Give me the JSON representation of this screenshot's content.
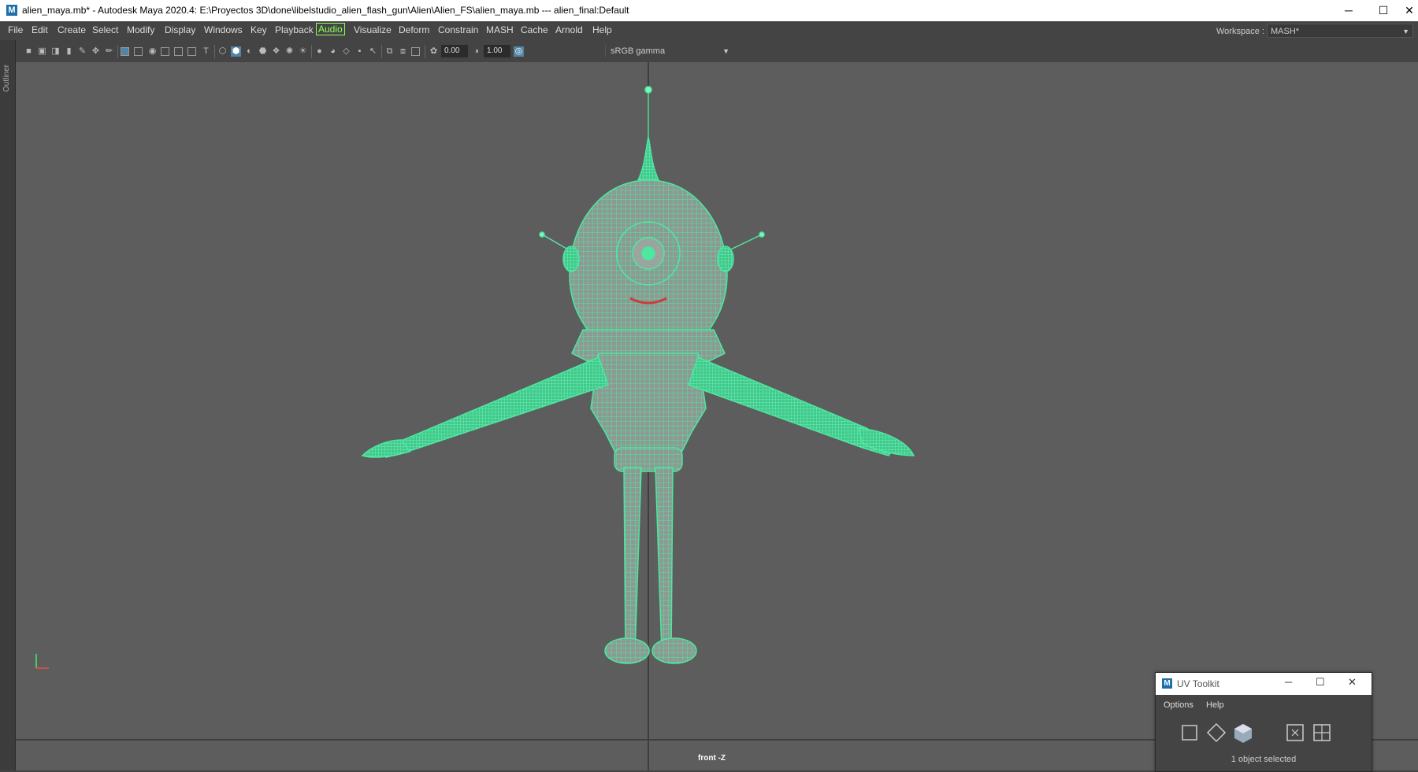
{
  "window": {
    "title": "alien_maya.mb* - Autodesk Maya 2020.4: E:\\Proyectos 3D\\done\\libelstudio_alien_flash_gun\\Alien\\Alien_FS\\alien_maya.mb  ---   alien_final:Default",
    "app_icon": "M",
    "controls": {
      "minimize": "─",
      "maximize": "☐",
      "close": "✕"
    }
  },
  "menubar": {
    "items": [
      "File",
      "Edit",
      "Create",
      "Select",
      "Modify",
      "Display",
      "Windows",
      "Key",
      "Playback",
      "Audio",
      "Visualize",
      "Deform",
      "Constrain",
      "MASH",
      "Cache",
      "Arnold",
      "Help"
    ],
    "workspace_label": "Workspace :",
    "workspace_value": "MASH*"
  },
  "sidebar": {
    "label": "Outliner"
  },
  "toolbar": {
    "exposure": "0.00",
    "gamma_value": "1.00",
    "color_space": "sRGB gamma"
  },
  "viewport": {
    "camera_label": "front -Z",
    "wire_color": "#4de8a0",
    "background": "#5d5d5d"
  },
  "uv_toolkit": {
    "title": "UV Toolkit",
    "app_icon": "M",
    "menu": [
      "Options",
      "Help"
    ],
    "status": "1 object selected",
    "icons": [
      "uv-rect-icon",
      "uv-diamond-icon",
      "uv-cube-icon",
      "uv-focus-icon",
      "uv-grid-icon"
    ]
  }
}
